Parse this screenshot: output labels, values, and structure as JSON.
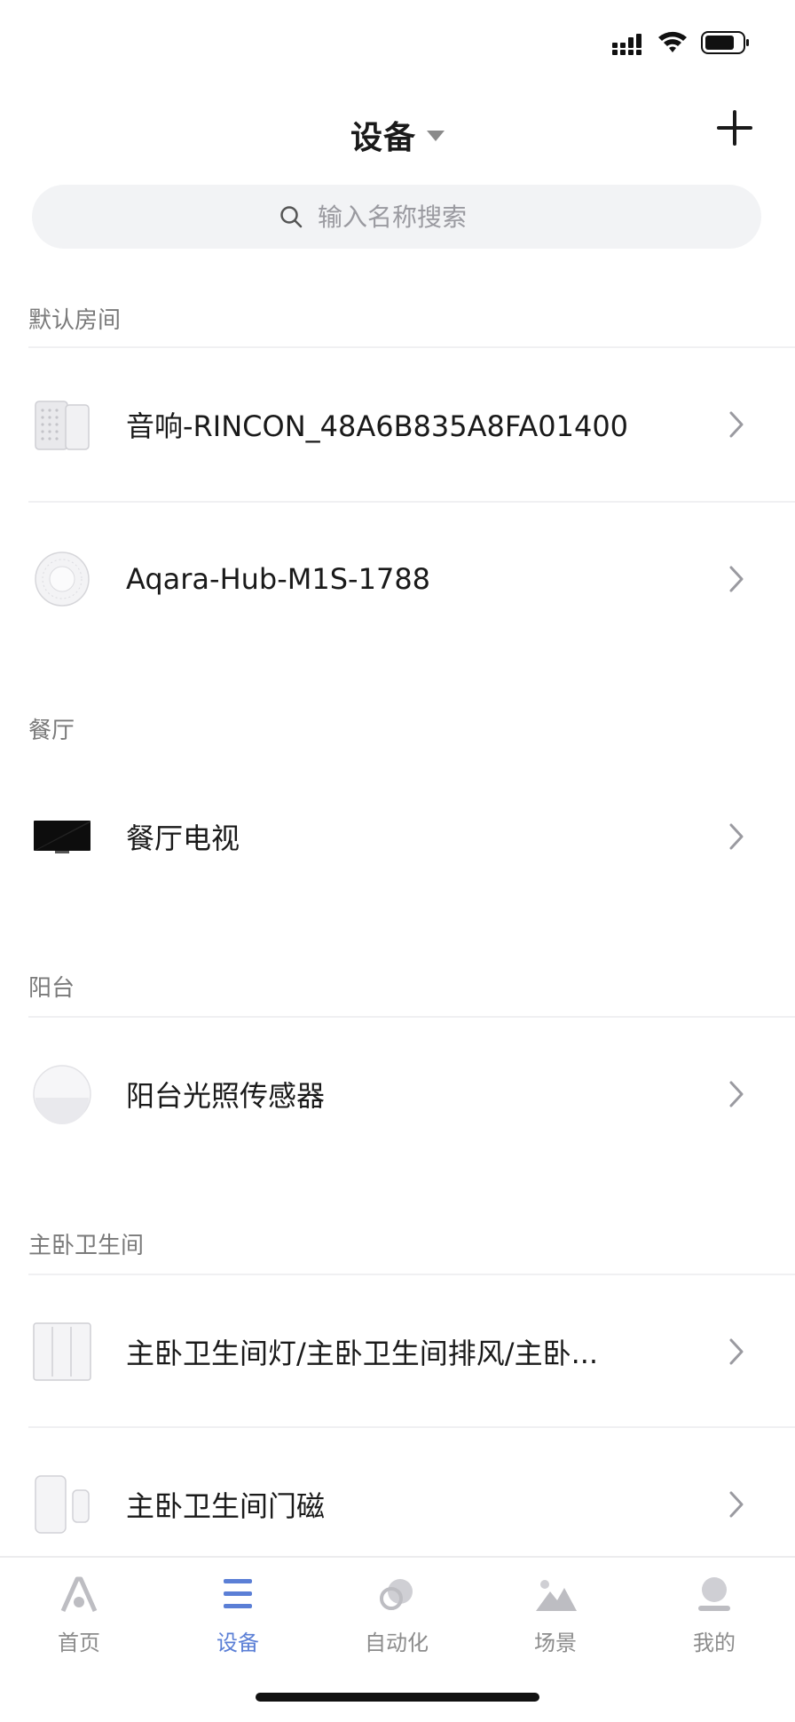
{
  "status_bar": {
    "icons": [
      "cellular-signal-icon",
      "wifi-icon",
      "battery-icon"
    ]
  },
  "header": {
    "title": "设备",
    "add_icon": "plus-icon"
  },
  "search": {
    "placeholder": "输入名称搜索",
    "icon": "search-icon"
  },
  "sections": [
    {
      "name": "默认房间",
      "devices": [
        {
          "name": "音响-RINCON_48A6B835A8FA01400",
          "icon": "speaker-icon"
        },
        {
          "name": "Aqara-Hub-M1S-1788",
          "icon": "hub-icon"
        }
      ]
    },
    {
      "name": "餐厅",
      "devices": [
        {
          "name": "餐厅电视",
          "icon": "tv-icon"
        }
      ]
    },
    {
      "name": "阳台",
      "devices": [
        {
          "name": "阳台光照传感器",
          "icon": "light-sensor-icon"
        }
      ]
    },
    {
      "name": "主卧卫生间",
      "devices": [
        {
          "name": "主卧卫生间灯/主卧卫生间排风/主卧...",
          "icon": "wall-switch-icon"
        },
        {
          "name": "主卧卫生间门磁",
          "icon": "door-sensor-icon"
        }
      ]
    }
  ],
  "tabbar": {
    "tabs": [
      {
        "label": "首页",
        "icon": "home-icon",
        "active": false
      },
      {
        "label": "设备",
        "icon": "devices-list-icon",
        "active": true
      },
      {
        "label": "自动化",
        "icon": "automation-icon",
        "active": false
      },
      {
        "label": "场景",
        "icon": "scene-icon",
        "active": false
      },
      {
        "label": "我的",
        "icon": "profile-icon",
        "active": false
      }
    ]
  },
  "colors": {
    "accent": "#5b7fd6",
    "inactive": "#8c8c8c",
    "section_text": "#7a7a7a",
    "search_bg": "#f2f3f5"
  }
}
